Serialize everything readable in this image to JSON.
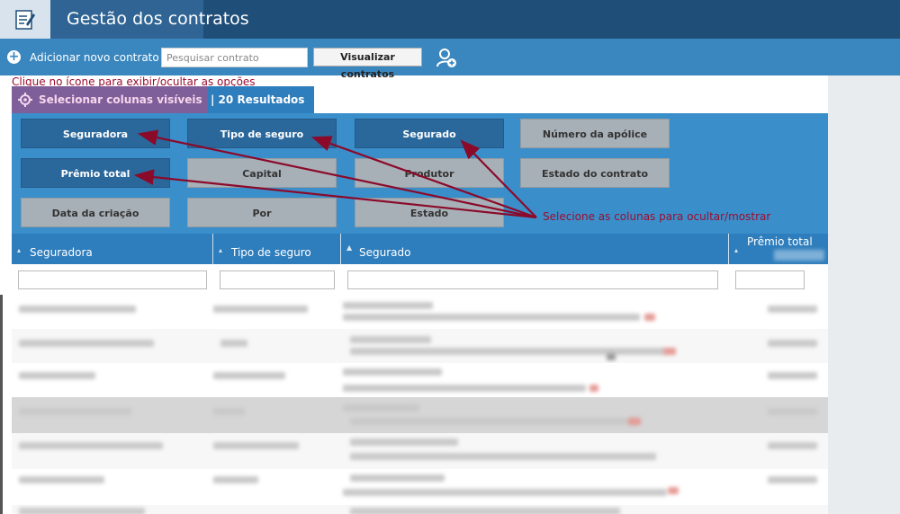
{
  "header": {
    "title": "Gestão dos contratos"
  },
  "toolbar": {
    "add_label": "Adicionar novo contrato",
    "search_placeholder": "Pesquisar contrato",
    "view_button": "Visualizar contratos"
  },
  "hint": "Clique no ícone para exibir/ocultar as opções",
  "tabs": {
    "select_columns": "Selecionar colunas visíveis",
    "results": "| 20 Resultados"
  },
  "columns_panel": {
    "buttons": [
      {
        "label": "Seguradora",
        "visible": true
      },
      {
        "label": "Tipo de seguro",
        "visible": true
      },
      {
        "label": "Segurado",
        "visible": true
      },
      {
        "label": "Número da apólice",
        "visible": false
      },
      {
        "label": "Prêmio total",
        "visible": true
      },
      {
        "label": "Capital",
        "visible": false
      },
      {
        "label": "Produtor",
        "visible": false
      },
      {
        "label": "Estado do contrato",
        "visible": false
      },
      {
        "label": "Data da criação",
        "visible": false
      },
      {
        "label": "Por",
        "visible": false
      },
      {
        "label": "Estado",
        "visible": false
      }
    ]
  },
  "annotation": "Selecione as colunas para ocultar/mostrar",
  "table": {
    "headers": [
      "Seguradora",
      "Tipo de seguro",
      "Segurado",
      "Prêmio total"
    ]
  },
  "colors": {
    "header": "#1f4e79",
    "toolbar": "#3a87bf",
    "accent": "#2e7dbc",
    "annotation": "#9b0d2e"
  }
}
